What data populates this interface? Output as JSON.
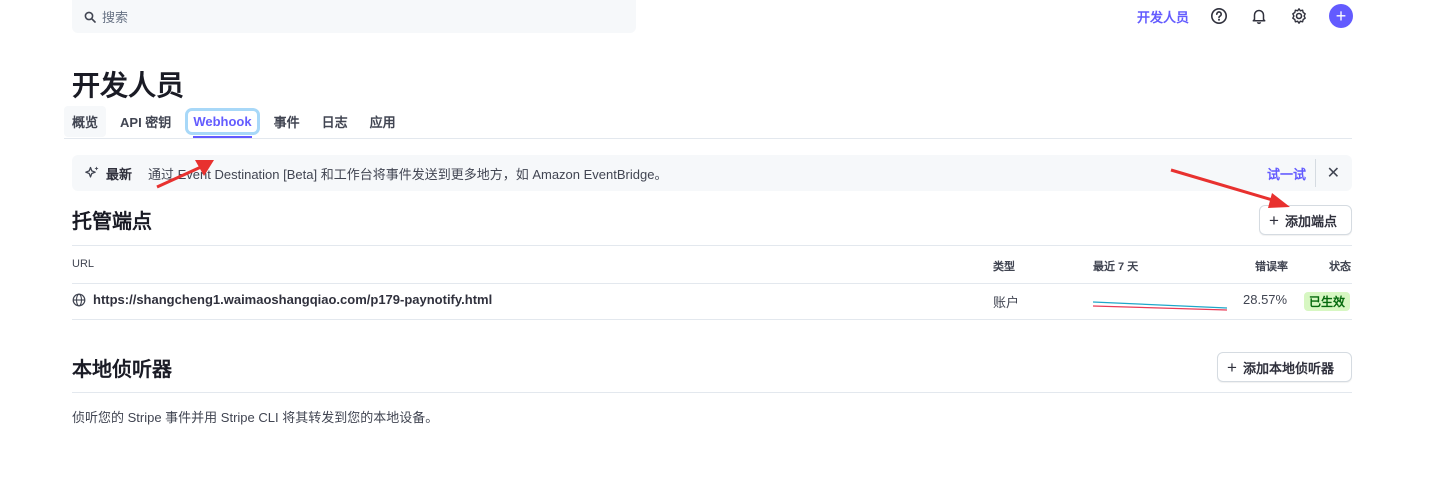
{
  "search": {
    "placeholder": "搜索"
  },
  "topbar": {
    "developers_link": "开发人员",
    "icons": [
      "help-icon",
      "bell-icon",
      "gear-icon",
      "plus-icon"
    ]
  },
  "page": {
    "title": "开发人员"
  },
  "tabs": [
    {
      "label": "概览"
    },
    {
      "label": "API 密钥"
    },
    {
      "label": "Webhook",
      "active": true
    },
    {
      "label": "事件"
    },
    {
      "label": "日志"
    },
    {
      "label": "应用"
    }
  ],
  "banner": {
    "badge": "最新",
    "text": "通过 Event Destination [Beta] 和工作台将事件发送到更多地方，如 Amazon EventBridge。",
    "action": "试一试"
  },
  "hosted": {
    "title": "托管端点",
    "add_button": "添加端点",
    "columns": {
      "url": "URL",
      "type": "类型",
      "last7": "最近 7 天",
      "error_rate": "错误率",
      "status": "状态"
    },
    "rows": [
      {
        "url": "https://shangcheng1.waimaoshangqiao.com/p179-paynotify.html",
        "type": "账户",
        "error_rate": "28.57%",
        "status": "已生效"
      }
    ]
  },
  "local": {
    "title": "本地侦听器",
    "add_button": "添加本地侦听器",
    "description": "侦听您的 Stripe 事件并用 Stripe CLI 将其转发到您的本地设备。"
  },
  "colors": {
    "accent": "#635bff",
    "success_bg": "#d7f7c2",
    "success_text": "#05690d",
    "annotation_arrow": "#e8312f"
  }
}
